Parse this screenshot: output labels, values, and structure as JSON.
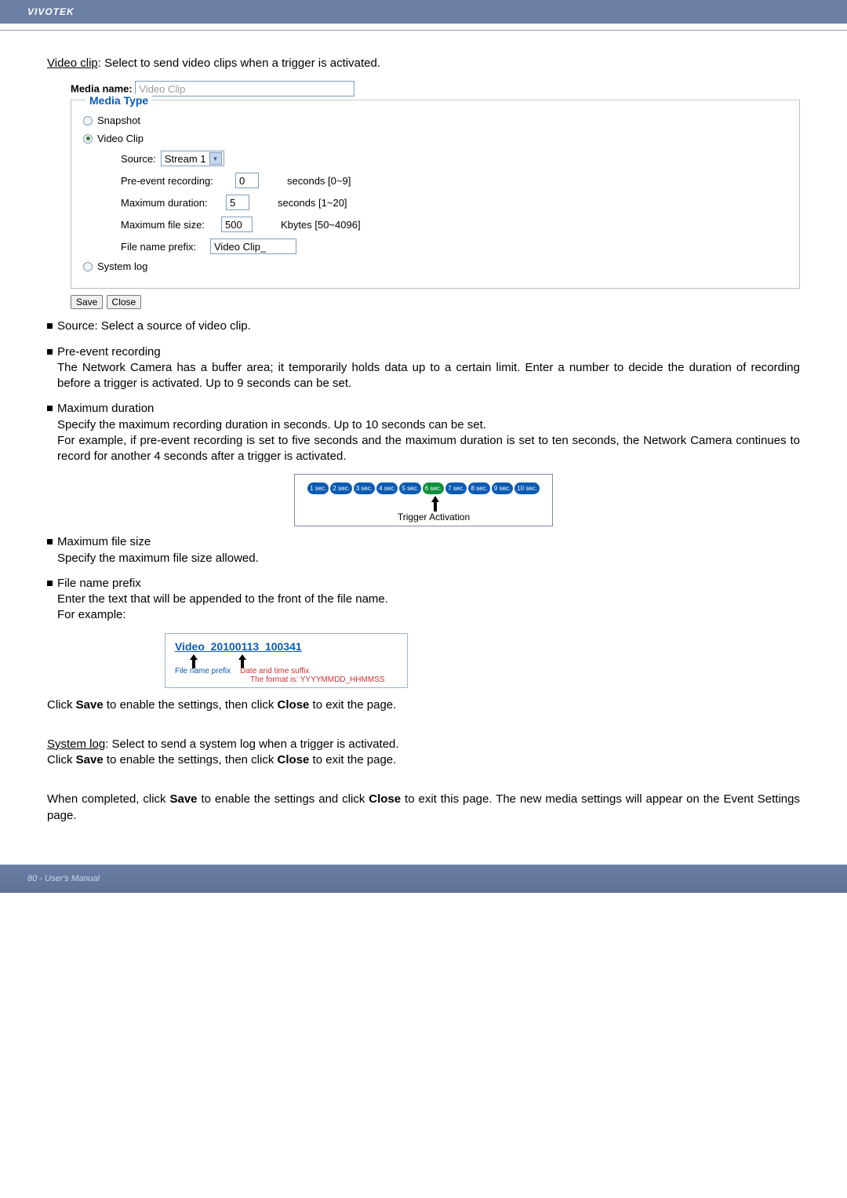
{
  "header": {
    "brand": "VIVOTEK"
  },
  "intro": {
    "video_clip_underline": "Video clip",
    "video_clip_desc": ": Select to send video clips when a trigger is activated."
  },
  "form": {
    "media_name_label": "Media name:",
    "media_name_value": "Video Clip",
    "legend": "Media Type",
    "snapshot_label": "Snapshot",
    "video_clip_label": "Video Clip",
    "source_label": "Source:",
    "source_value": "Stream 1",
    "pre_event_label": "Pre-event recording:",
    "pre_event_value": "0",
    "pre_event_hint": "seconds [0~9]",
    "max_dur_label": "Maximum duration:",
    "max_dur_value": "5",
    "max_dur_hint": "seconds [1~20]",
    "max_size_label": "Maximum file size:",
    "max_size_value": "500",
    "max_size_hint": "Kbytes [50~4096]",
    "prefix_label": "File name prefix:",
    "prefix_value": "Video Clip_",
    "system_log_label": "System log",
    "save_btn": "Save",
    "close_btn": "Close"
  },
  "bullets": {
    "source": "Source: Select a source of video clip.",
    "pre_title": "Pre-event recording",
    "pre_body": "The Network Camera has a buffer area; it temporarily holds data up to a certain limit. Enter a number to decide the duration of recording before a trigger is activated. Up to 9 seconds can be set.",
    "max_dur_title": "Maximum duration",
    "max_dur_body1": "Specify the maximum recording duration in seconds. Up to 10 seconds can be set.",
    "max_dur_body2": "For example, if pre-event recording is set to five seconds and the maximum duration is set to ten seconds, the Network Camera continues to record for another 4 seconds after a trigger is activated.",
    "max_size_title": "Maximum file size",
    "max_size_body": "Specify the maximum file size allowed.",
    "prefix_title": "File name prefix",
    "prefix_body": "Enter the text that will be appended to the front of the file name.",
    "for_example": " For example:"
  },
  "timeline": {
    "secs": [
      "1 sec.",
      "2 sec.",
      "3 sec.",
      "4 sec.",
      "5 sec.",
      "6 sec.",
      "7 sec.",
      "8 sec.",
      "9 sec.",
      "10 sec."
    ],
    "active_index": 5,
    "trigger_label": "Trigger Activation"
  },
  "prefixbox": {
    "title": "Video_20100113_100341",
    "caption1": "File name prefix",
    "caption2": "Date and time suffix",
    "sub": "The format is: YYYYMMDD_HHMMSS"
  },
  "after": {
    "save_line1a": "Click ",
    "save_bold1": "Save",
    "save_line1b": " to enable the settings, then click ",
    "close_bold1": "Close",
    "save_line1c": " to exit the page.",
    "syslog_under": "System log",
    "syslog_desc": ": Select to send a system log when a trigger is activated.",
    "complete_a": "When completed, click ",
    "complete_b": " to enable the settings and click ",
    "complete_c": " to exit this page. The new media settings will appear on the Event Settings page."
  },
  "footer": {
    "page": "80 - User's Manual"
  }
}
